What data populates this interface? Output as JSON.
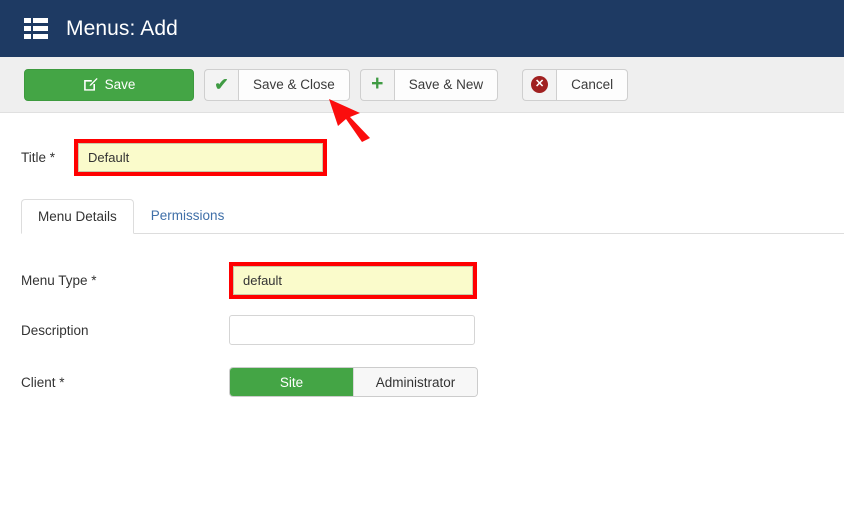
{
  "header": {
    "title": "Menus: Add",
    "icon": "menu-grid-icon",
    "background_color": "#1e3a63",
    "text_color": "#ffffff"
  },
  "toolbar": {
    "background_color": "#efefef",
    "buttons": [
      {
        "id": "save",
        "label": "Save",
        "icon": "edit-square-icon",
        "style": "primary-green",
        "color": "#44a545"
      },
      {
        "id": "save-close",
        "label": "Save & Close",
        "icon": "check-icon",
        "style": "split-default",
        "icon_color": "#3f9b43"
      },
      {
        "id": "save-new",
        "label": "Save & New",
        "icon": "plus-icon",
        "style": "split-default",
        "icon_color": "#3f9b43"
      },
      {
        "id": "cancel",
        "label": "Cancel",
        "icon": "close-circle-icon",
        "style": "split-default",
        "icon_color": "#a02020"
      }
    ]
  },
  "form": {
    "title_field": {
      "label": "Title *",
      "value": "Default",
      "placeholder": "",
      "highlighted": true,
      "highlight_color": "#ff0000",
      "input_background": "#fafbcb"
    },
    "tabs": [
      {
        "id": "menu-details",
        "label": "Menu Details",
        "active": true
      },
      {
        "id": "permissions",
        "label": "Permissions",
        "active": false
      }
    ],
    "menu_type_field": {
      "label": "Menu Type *",
      "value": "default",
      "placeholder": "",
      "highlighted": true,
      "highlight_color": "#ff0000",
      "input_background": "#fafbcb"
    },
    "description_field": {
      "label": "Description",
      "value": "",
      "placeholder": ""
    },
    "client_field": {
      "label": "Client *",
      "selected": "Site",
      "options": [
        {
          "label": "Site",
          "selected": true
        },
        {
          "label": "Administrator",
          "selected": false
        }
      ],
      "selected_color": "#44a545"
    }
  },
  "annotations": {
    "arrow": {
      "name": "red-arrow-pointing-to-save-and-close",
      "color": "#ff0000",
      "points_to": "Save & Close"
    }
  }
}
